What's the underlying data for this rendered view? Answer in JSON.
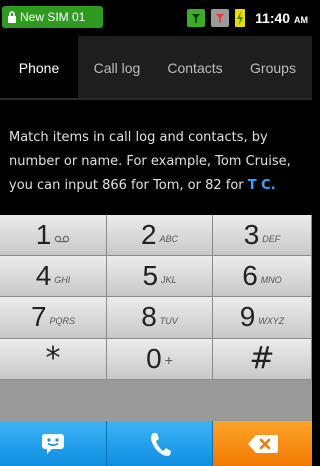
{
  "status_bar": {
    "sim_label": "New SIM 01",
    "time": "11:40",
    "ampm": "AM",
    "icons": [
      "lock-icon",
      "signal-icon",
      "signal-icon-gray",
      "battery-icon"
    ]
  },
  "tabs": [
    {
      "label": "Phone",
      "active": true
    },
    {
      "label": "Call log",
      "active": false
    },
    {
      "label": "Contacts",
      "active": false
    },
    {
      "label": "Groups",
      "active": false
    }
  ],
  "hint": {
    "text": "Match items in call log and contacts, by number or name. For example, Tom Cruise, you can input 866 for Tom, or 82 for ",
    "highlight": "T C."
  },
  "keypad": [
    {
      "digit": "1",
      "letters": "voicemail"
    },
    {
      "digit": "2",
      "letters": "ABC"
    },
    {
      "digit": "3",
      "letters": "DEF"
    },
    {
      "digit": "4",
      "letters": "GHI"
    },
    {
      "digit": "5",
      "letters": "JKL"
    },
    {
      "digit": "6",
      "letters": "MNO"
    },
    {
      "digit": "7",
      "letters": "PQRS"
    },
    {
      "digit": "8",
      "letters": "TUV"
    },
    {
      "digit": "9",
      "letters": "WXYZ"
    },
    {
      "digit": "*",
      "letters": ""
    },
    {
      "digit": "0",
      "letters": "+"
    },
    {
      "digit": "#",
      "letters": ""
    }
  ],
  "actions": {
    "message_icon": "message-icon",
    "call_icon": "phone-icon",
    "delete_icon": "backspace-icon",
    "colors": {
      "blue": "#1a9ae6",
      "orange": "#f58a10"
    }
  }
}
